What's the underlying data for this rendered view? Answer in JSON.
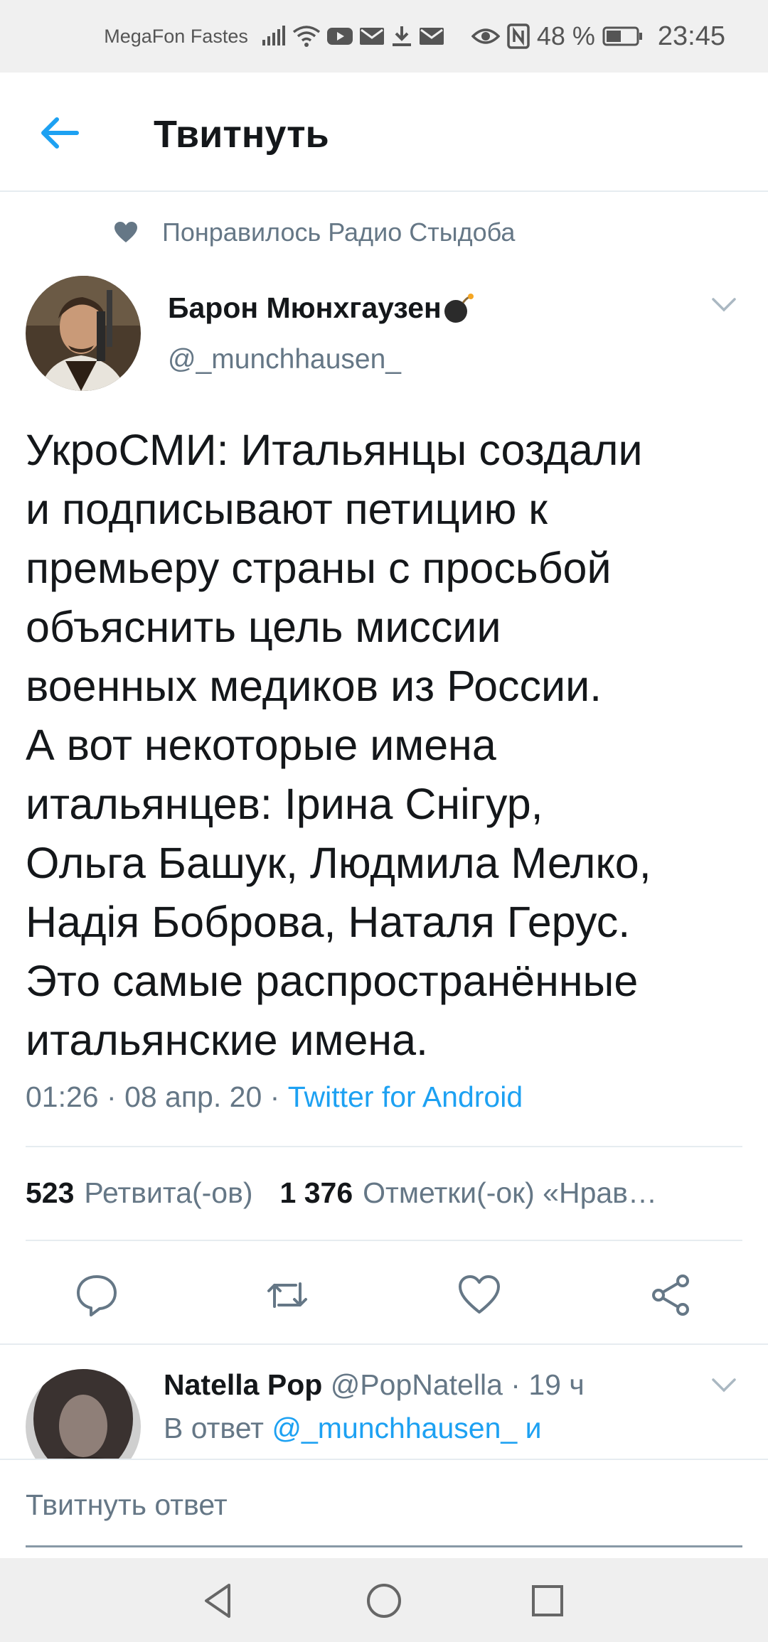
{
  "status_bar": {
    "carrier": "MegaFon Fastes",
    "battery_percent": "48 %",
    "time": "23:45",
    "icons": [
      "signal-icon",
      "wifi-icon",
      "youtube-icon",
      "mail-icon",
      "download-icon",
      "mail-icon",
      "eye-icon",
      "nfc-icon",
      "battery-icon"
    ]
  },
  "header": {
    "title": "Твитнуть"
  },
  "social_context": {
    "text": "Понравилось Радио Стыдоба"
  },
  "tweet": {
    "author_name": "Барон Мюнхгаузен",
    "author_handle": "@_munchhausen_",
    "text": "УкроСМИ: Итальянцы создали\nи подписывают петицию к\nпремьеру страны с просьбой\nобъяснить цель миссии\nвоенных медиков из России.\nА вот некоторые имена\nитальянцев: Ірина Снігур,\nОльга Башук, Людмила Мелко,\nНадія Боброва, Наталя Герус.\nЭто самые распространённые\nитальянские имена.",
    "time": "01:26",
    "date": "08 апр. 20",
    "source": "Twitter for Android",
    "retweets_count": "523",
    "retweets_label": "Ретвита(-ов)",
    "likes_count": "1 376",
    "likes_label": "Отметки(-ок) «Нрав…"
  },
  "reply": {
    "author_name": "Natella Pop",
    "author_handle": "@PopNatella",
    "age": "· 19 ч",
    "reply_prefix": "В ответ",
    "reply_mentions": "@_munchhausen_ и"
  },
  "compose": {
    "placeholder": "Твитнуть ответ"
  },
  "colors": {
    "accent": "#1da1f2",
    "secondary_text": "#657786",
    "primary_text": "#14171a",
    "divider": "#e6ecf0"
  }
}
